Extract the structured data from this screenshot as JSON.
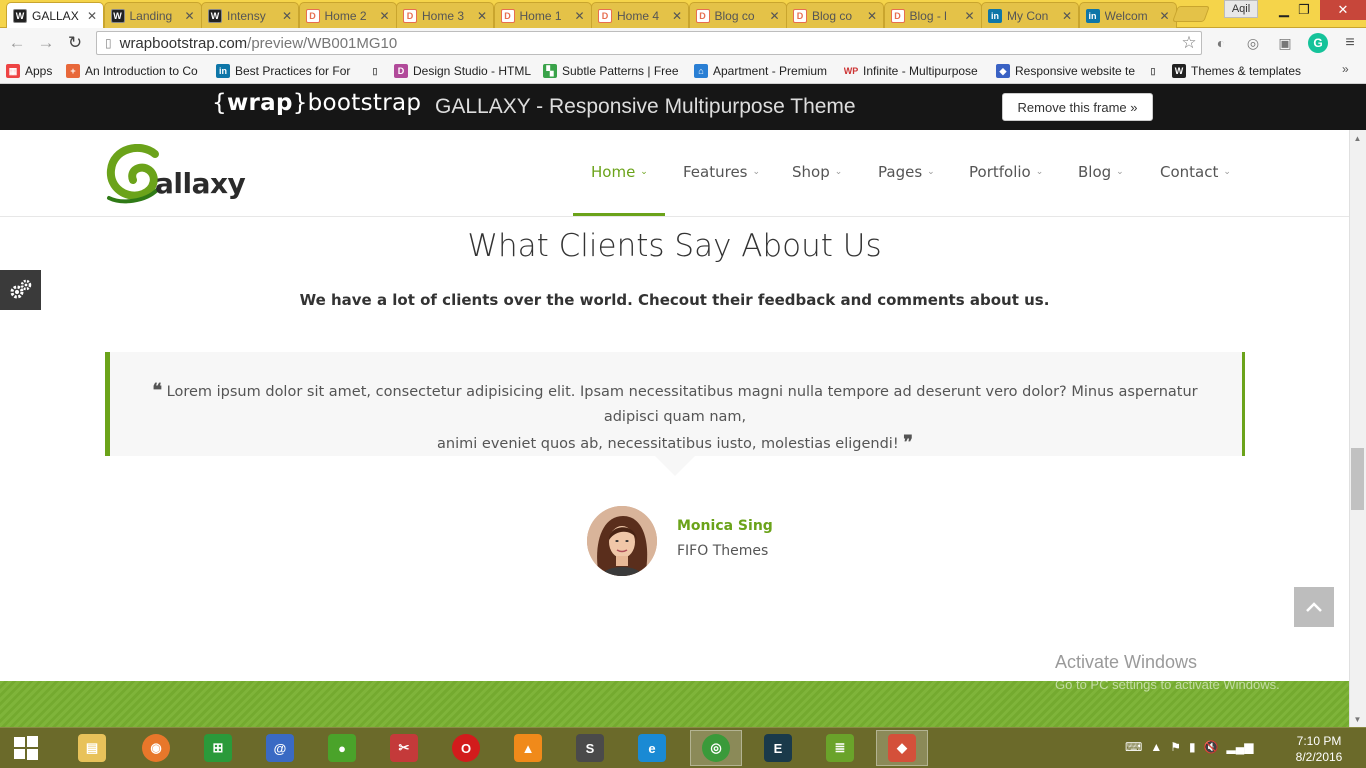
{
  "browser": {
    "tabs": [
      {
        "title": "GALLAX",
        "icon": "wrapbootstrap-icon",
        "active": true
      },
      {
        "title": "Landing",
        "icon": "wrapbootstrap-icon"
      },
      {
        "title": "Intensy",
        "icon": "wrapbootstrap-icon"
      },
      {
        "title": "Home 2",
        "icon": "d-icon"
      },
      {
        "title": "Home 3",
        "icon": "d-icon"
      },
      {
        "title": "Home 1",
        "icon": "d-icon"
      },
      {
        "title": "Home 4",
        "icon": "d-icon"
      },
      {
        "title": "Blog co",
        "icon": "d-icon"
      },
      {
        "title": "Blog co",
        "icon": "d-icon"
      },
      {
        "title": "Blog - l",
        "icon": "d-icon"
      },
      {
        "title": "My Con",
        "icon": "linkedin-icon"
      },
      {
        "title": "Welcom",
        "icon": "linkedin-icon"
      }
    ],
    "user": "Aqil",
    "url_host": "wrapbootstrap.com",
    "url_path": "/preview/WB001MG10",
    "bookmarks": [
      {
        "label": "Apps",
        "icon": "apps-grid-icon"
      },
      {
        "label": "An Introduction to Co",
        "icon": "plus-icon"
      },
      {
        "label": "Best Practices for For",
        "icon": "linkedin-icon"
      },
      {
        "label": "",
        "icon": "page-icon"
      },
      {
        "label": "Design Studio - HTML",
        "icon": "d-icon"
      },
      {
        "label": "Subtle Patterns | Free",
        "icon": "pattern-icon"
      },
      {
        "label": "Apartment - Premium",
        "icon": "home-icon"
      },
      {
        "label": "Infinite - Multipurpose",
        "icon": "wp-icon"
      },
      {
        "label": "Responsive website te",
        "icon": "shield-icon"
      },
      {
        "label": "",
        "icon": "page-icon"
      },
      {
        "label": "Themes & templates",
        "icon": "wrapbootstrap-icon"
      }
    ]
  },
  "frame": {
    "logo_brace_open": "{",
    "logo_wrap": "wrap",
    "logo_brace_close": "}",
    "logo_rest": "bootstrap",
    "theme_title": "GALLAXY - Responsive Multipurpose Theme",
    "remove_button": "Remove this frame »"
  },
  "site": {
    "brand": "allaxy",
    "nav": [
      {
        "label": "Home",
        "active": true
      },
      {
        "label": "Features"
      },
      {
        "label": "Shop"
      },
      {
        "label": "Pages"
      },
      {
        "label": "Portfolio"
      },
      {
        "label": "Blog"
      },
      {
        "label": "Contact"
      }
    ],
    "section_title": "What Clients Say About Us",
    "section_subtitle": "We have a lot of clients over the world. Checout their feedback and comments about us.",
    "quote_open": "❝",
    "quote_line1": "Lorem ipsum dolor sit amet, consectetur adipisicing elit. Ipsam necessitatibus magni nulla tempore ad deserunt vero dolor? Minus aspernatur adipisci quam nam,",
    "quote_line2": "animi eveniet quos ab, necessitatibus iusto, molestias eligendi!",
    "quote_close": "❞",
    "client_name": "Monica Sing",
    "client_company": "FIFO Themes"
  },
  "watermark": {
    "title": "Activate Windows",
    "subtitle": "Go to PC settings to activate Windows."
  },
  "taskbar": {
    "apps": [
      "file-explorer-icon",
      "firefox-icon",
      "store-icon",
      "remote-desktop-icon",
      "frog-icon",
      "snipping-icon",
      "opera-icon",
      "vlc-icon",
      "sublime-icon",
      "ie-icon",
      "chrome-icon",
      "editor-icon",
      "stack-icon",
      "git-icon"
    ],
    "time": "7:10 PM",
    "date": "8/2/2016"
  },
  "colors": {
    "accent": "#6ba31a",
    "frame_bar": "#161616",
    "taskbar": "#6b6a2a",
    "tabstrip": "#f5d44a"
  }
}
